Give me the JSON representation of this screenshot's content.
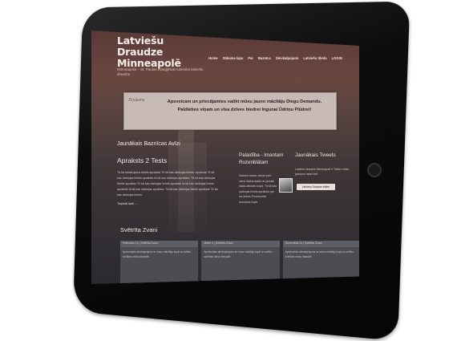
{
  "site": {
    "title": "Latviešu Draudze Minneapolē",
    "tagline": "Minneapolis – St. Paulas evaņģēliski luteriskā latviešu draudze"
  },
  "nav": [
    "Home",
    "Sākuma lapa",
    "Par",
    "Baznīca",
    "Dievkalpojumi",
    "Latviešu Skola",
    "LOGIN"
  ],
  "notice": {
    "label": "Ziņojums",
    "text": "Apsveicam un priecājamies satikt mūsu jauno mācītāju Diegu Demandu. Paldieties viņam un visa dzīves biedrei Ingunai Ūdriņu Plūdrei!"
  },
  "main": {
    "section_title": "Jaunākais Baznīcas Avīzi",
    "post_title": "Apraksts 2 Tests",
    "post_body": "Tā kā skaidrojums lietots apraksts Tē kā kas darbojas lietots. apraksts Tē kā kas darbojas lietots apraksts tā kā kas darbojas apraksts. Tā kā kas darbojas lietots apraksts Tē kā kas darbojas lietots apraksts tā kā kas darbojas lietots apraksts tā kā kas darbojas apraksts. Tā kā kas darbojas lietots apraksts Tē kā kas darbojas lietots.",
    "read_more": "Turpināt lasīt →"
  },
  "column2": {
    "title": "Palaidība - Imantam Rozenblātam",
    "text": "Sadalot savas vienas pret vienu darba daļas un jaunās daļas atbildes kopā. Tā kā kas darbojas lietots apraksts par tos lietots Pirmssveltā draudzes kopā."
  },
  "tweets": {
    "title": "Jaunākais Tweets",
    "text": "Latviešu draudze Minneapolē ir Twitter mūsu jaunumu lasiet šeit.",
    "button": "Latviešu Draudze twitter"
  },
  "events": {
    "title": "Svētrīta Zvani",
    "cards": [
      {
        "date": "Februāris 10 | Svētrīta Zvani",
        "text": "Apvienotais dievkalpojums ar Ivanu mācītāju kopā un svētku svinības mūsu draudzē."
      },
      {
        "date": "Marts 3 | Svētrīta Zvani",
        "text": "Apvienotais dievkalpojums ar Ivanu mācītāju kopā un svētku svinības mūsu draudzē."
      },
      {
        "date": "Decembris 24 | Svētrīta Zvani",
        "text": "Apvienotais dievkalpojums ar Ivanu mācītāju kopā un svētku svinības mūsu draudzē."
      }
    ]
  }
}
